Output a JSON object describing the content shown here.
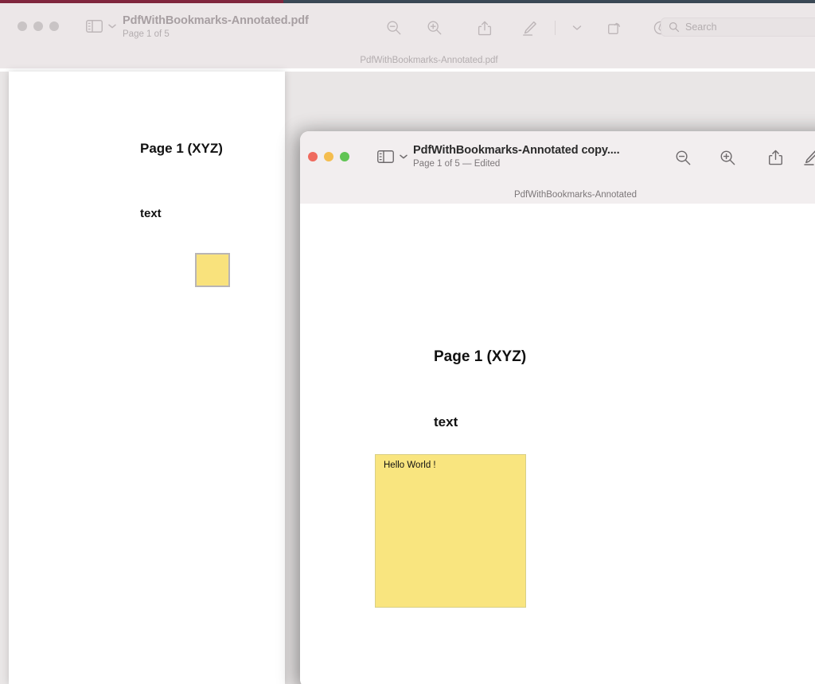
{
  "desktop": {
    "wallpaper_left_color": "#8e2a44",
    "wallpaper_right_color": "#41505e"
  },
  "background_window": {
    "state": "inactive",
    "title": "PdfWithBookmarks-Annotated.pdf",
    "subtitle": "Page 1 of 5",
    "proxy_title": "PdfWithBookmarks-Annotated.pdf",
    "traffic_lights": [
      {
        "name": "close",
        "color": "#c9c4c5"
      },
      {
        "name": "minimize",
        "color": "#c9c4c5"
      },
      {
        "name": "zoom",
        "color": "#c9c4c5"
      }
    ],
    "toolbar": {
      "sidebar_label": "Sidebar",
      "icons": [
        {
          "name": "zoom-out-icon",
          "label": "Zoom Out"
        },
        {
          "name": "zoom-in-icon",
          "label": "Zoom In"
        },
        {
          "name": "share-icon",
          "label": "Share"
        },
        {
          "name": "markup-pen-icon",
          "label": "Markup"
        },
        {
          "name": "chevron-down-icon",
          "label": "Markup Options"
        },
        {
          "name": "rotate-right-icon",
          "label": "Rotate"
        },
        {
          "name": "annotate-icon",
          "label": "Annotate"
        }
      ],
      "search_placeholder": "Search"
    },
    "page": {
      "heading": "Page 1 (XYZ)",
      "body_text": "text",
      "note": {
        "color": "#f9e27c",
        "border_color": "#b9b5b5",
        "text": ""
      }
    }
  },
  "front_window": {
    "state": "active",
    "title": "PdfWithBookmarks-Annotated copy....",
    "subtitle": "Page 1 of 5 — Edited",
    "proxy_title": "PdfWithBookmarks-Annotated",
    "traffic_lights": [
      {
        "name": "close",
        "color": "#ef6a5e"
      },
      {
        "name": "minimize",
        "color": "#f4bd4f"
      },
      {
        "name": "zoom",
        "color": "#61c454"
      }
    ],
    "toolbar": {
      "sidebar_label": "Sidebar",
      "icons": [
        {
          "name": "zoom-out-icon",
          "label": "Zoom Out"
        },
        {
          "name": "zoom-in-icon",
          "label": "Zoom In"
        },
        {
          "name": "share-icon",
          "label": "Share"
        },
        {
          "name": "markup-pen-icon",
          "label": "Markup"
        }
      ]
    },
    "page": {
      "heading": "Page 1 (XYZ)",
      "body_text": "text",
      "note": {
        "color": "#f9e57f",
        "border_color": "#d9cf86",
        "text": "Hello World !"
      }
    }
  }
}
